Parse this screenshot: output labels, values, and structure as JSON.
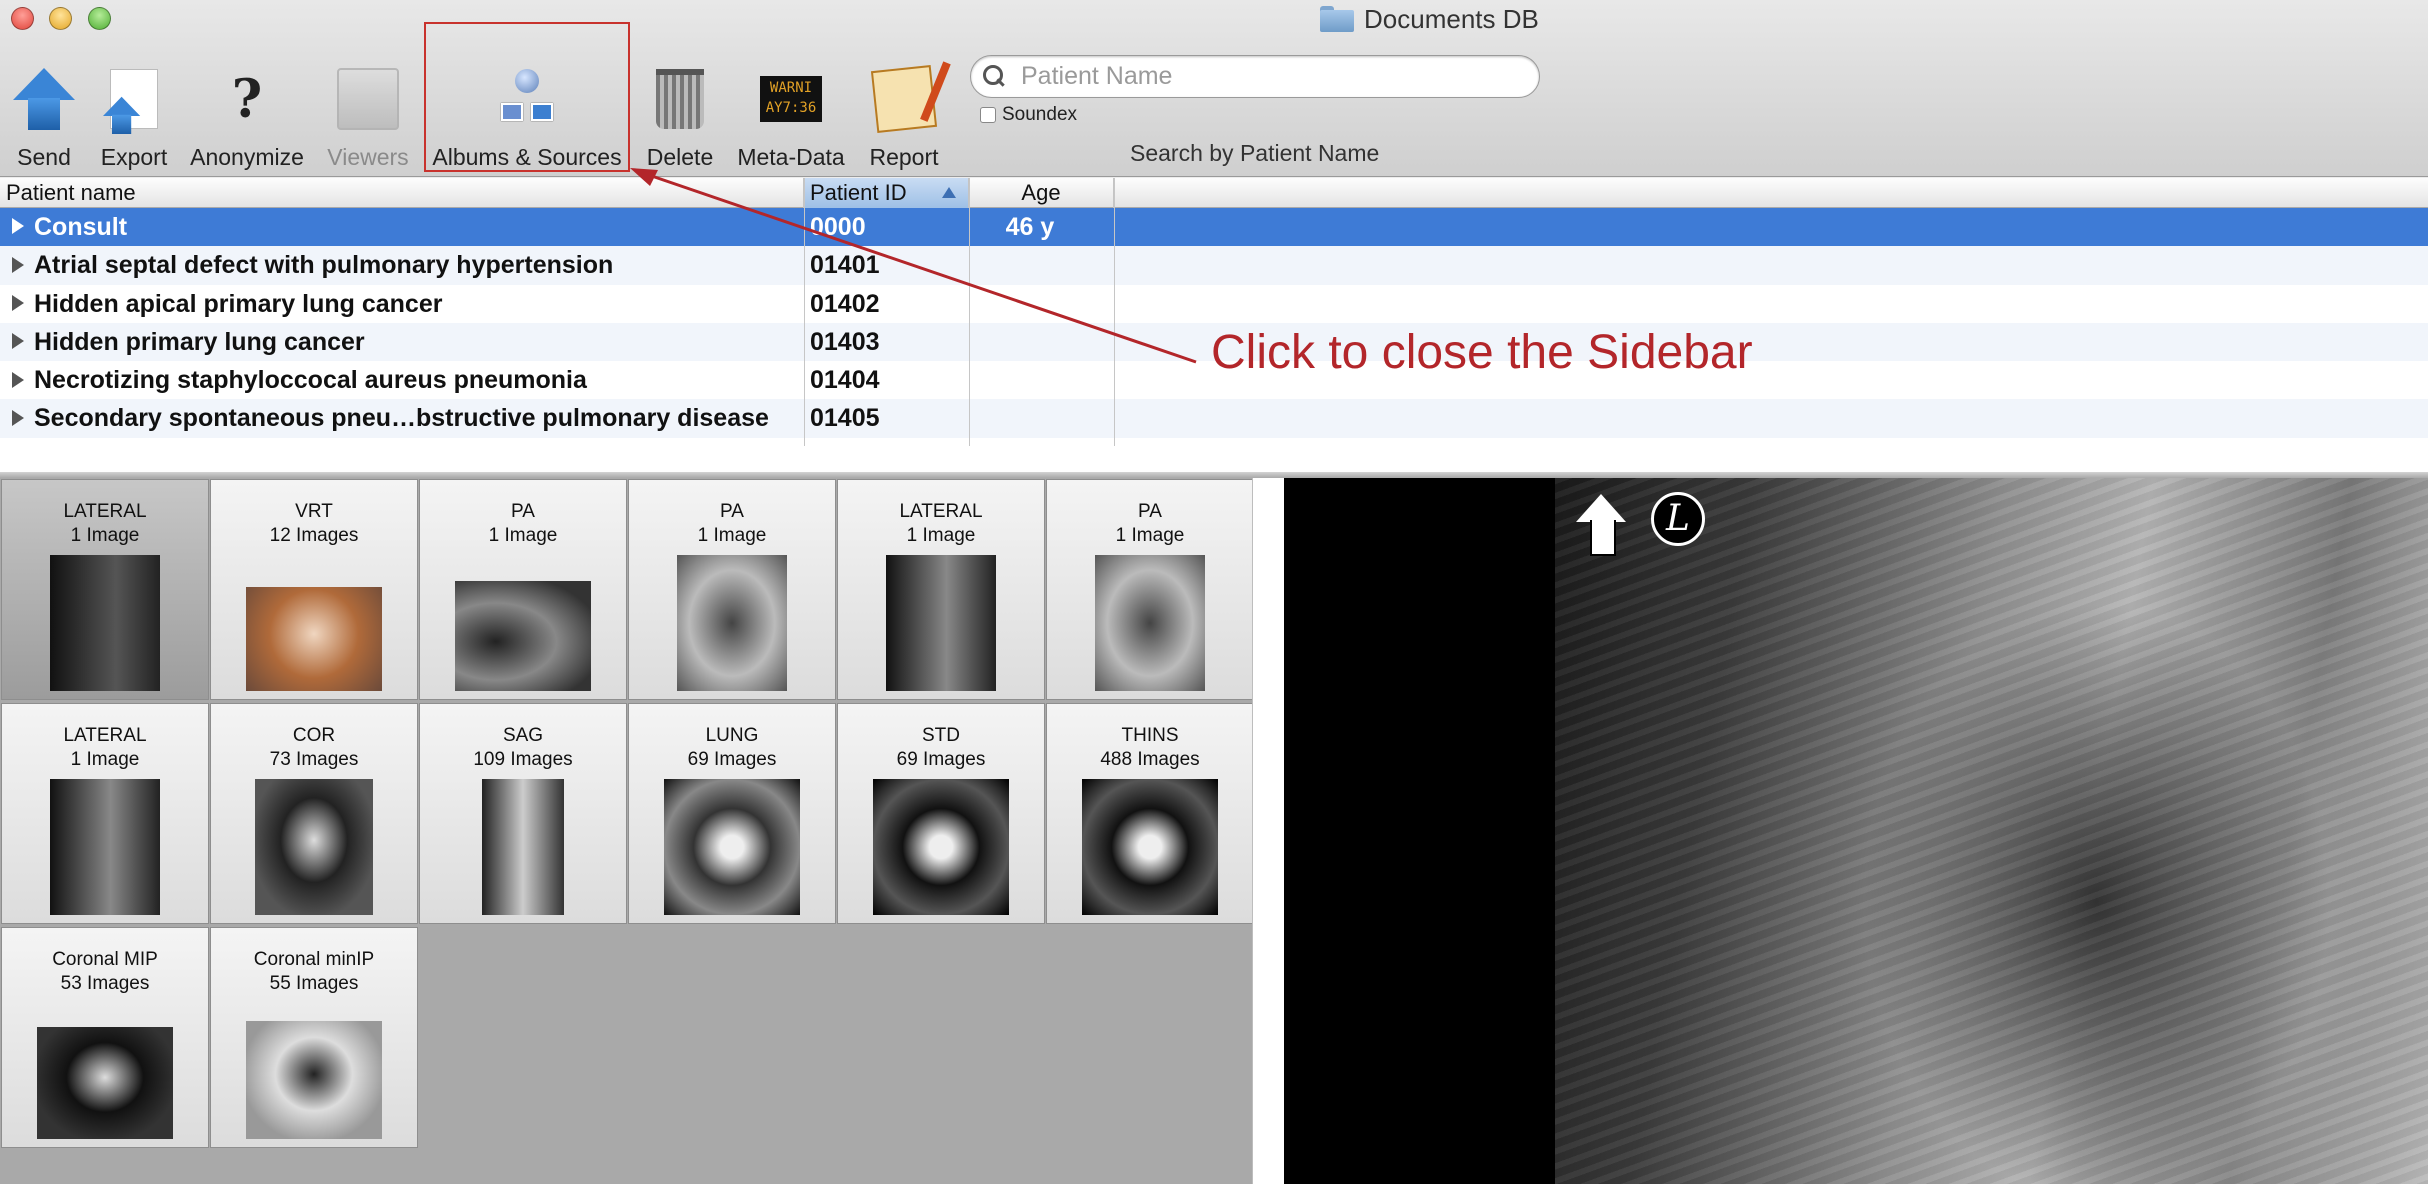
{
  "window": {
    "title": "Documents DB"
  },
  "toolbar": {
    "items": [
      {
        "label": "Send",
        "icon": "send-icon",
        "enabled": true
      },
      {
        "label": "Export",
        "icon": "export-icon",
        "enabled": true
      },
      {
        "label": "Anonymize",
        "icon": "anonymize-icon",
        "enabled": true
      },
      {
        "label": "Viewers",
        "icon": "viewers-icon",
        "enabled": false
      },
      {
        "label": "Albums & Sources",
        "icon": "albums-sources-icon",
        "enabled": true
      },
      {
        "label": "Delete",
        "icon": "trash-icon",
        "enabled": true
      },
      {
        "label": "Meta-Data",
        "icon": "meta-data-icon",
        "enabled": true
      },
      {
        "label": "Report",
        "icon": "report-icon",
        "enabled": true
      }
    ],
    "meta_icon_text": "WARNI AY7:36",
    "search": {
      "placeholder": "Patient Name",
      "value": "",
      "soundex_label": "Soundex",
      "soundex_checked": false,
      "caption": "Search by Patient Name"
    }
  },
  "table": {
    "columns": [
      "Patient name",
      "Patient ID",
      "Age"
    ],
    "sorted_column": "Patient ID",
    "rows": [
      {
        "name": "Consult",
        "id": "0000",
        "age": "46 y",
        "selected": true
      },
      {
        "name": "Atrial septal defect with pulmonary hypertension",
        "id": "01401",
        "age": ""
      },
      {
        "name": "Hidden apical primary lung cancer",
        "id": "01402",
        "age": ""
      },
      {
        "name": "Hidden primary lung cancer",
        "id": "01403",
        "age": ""
      },
      {
        "name": "Necrotizing staphyloccocal aureus pneumonia",
        "id": "01404",
        "age": ""
      },
      {
        "name": "Secondary spontaneous pneu…bstructive pulmonary disease",
        "id": "01405",
        "age": ""
      }
    ]
  },
  "series": [
    {
      "name": "LATERAL",
      "count": "1 Image"
    },
    {
      "name": "VRT",
      "count": "12 Images"
    },
    {
      "name": "PA",
      "count": "1 Image"
    },
    {
      "name": "PA",
      "count": "1 Image"
    },
    {
      "name": "LATERAL",
      "count": "1 Image"
    },
    {
      "name": "PA",
      "count": "1 Image"
    },
    {
      "name": "LATERAL",
      "count": "1 Image"
    },
    {
      "name": "COR",
      "count": "73 Images"
    },
    {
      "name": "SAG",
      "count": "109 Images"
    },
    {
      "name": "LUNG",
      "count": "69 Images"
    },
    {
      "name": "STD",
      "count": "69 Images"
    },
    {
      "name": "THINS",
      "count": "488 Images"
    },
    {
      "name": "Coronal MIP",
      "count": "53 Images"
    },
    {
      "name": "Coronal minIP",
      "count": "55 Images"
    }
  ],
  "viewer": {
    "orientation_marker": "L"
  },
  "annotation": {
    "text": "Click to close the Sidebar",
    "color": "#b3262a"
  }
}
